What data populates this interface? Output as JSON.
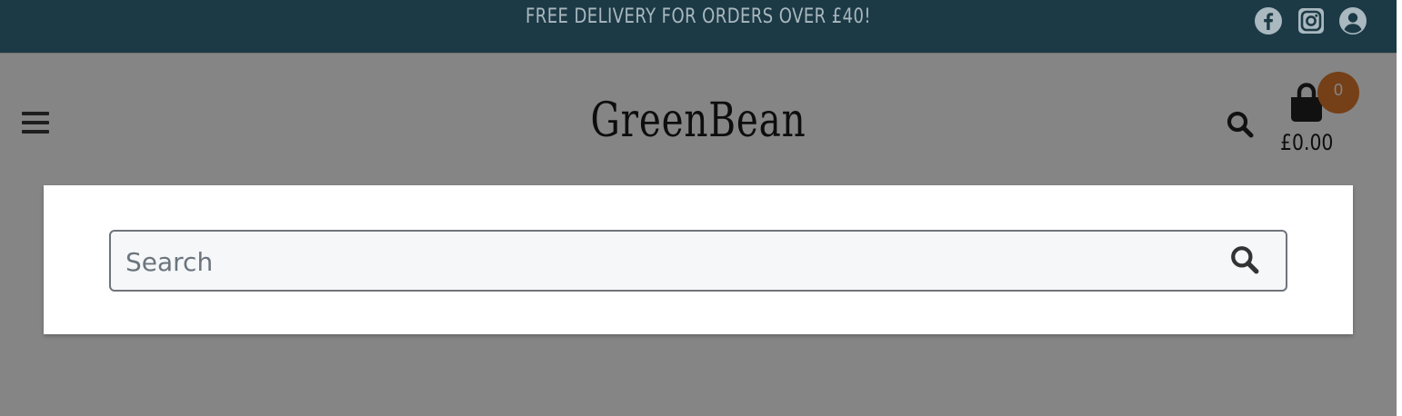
{
  "topbar": {
    "promo_text": "FREE DELIVERY FOR ORDERS OVER £40!",
    "social_icons": [
      "facebook-icon",
      "instagram-icon",
      "account-icon"
    ]
  },
  "header": {
    "logo_text": "GreenBean",
    "menu_icon": "hamburger-icon",
    "search_icon": "search-icon",
    "cart": {
      "icon": "shopping-bag-icon",
      "count": "0",
      "total": "£0.00"
    }
  },
  "search_modal": {
    "placeholder": "Search",
    "value": "",
    "submit_icon": "search-icon"
  },
  "colors": {
    "topbar_bg": "#1c3a46",
    "promo_text": "#aab8bf",
    "cart_badge": "#e07a2c",
    "overlay": "rgba(0,0,0,0.48)",
    "search_field_bg": "#f5f7f9"
  }
}
